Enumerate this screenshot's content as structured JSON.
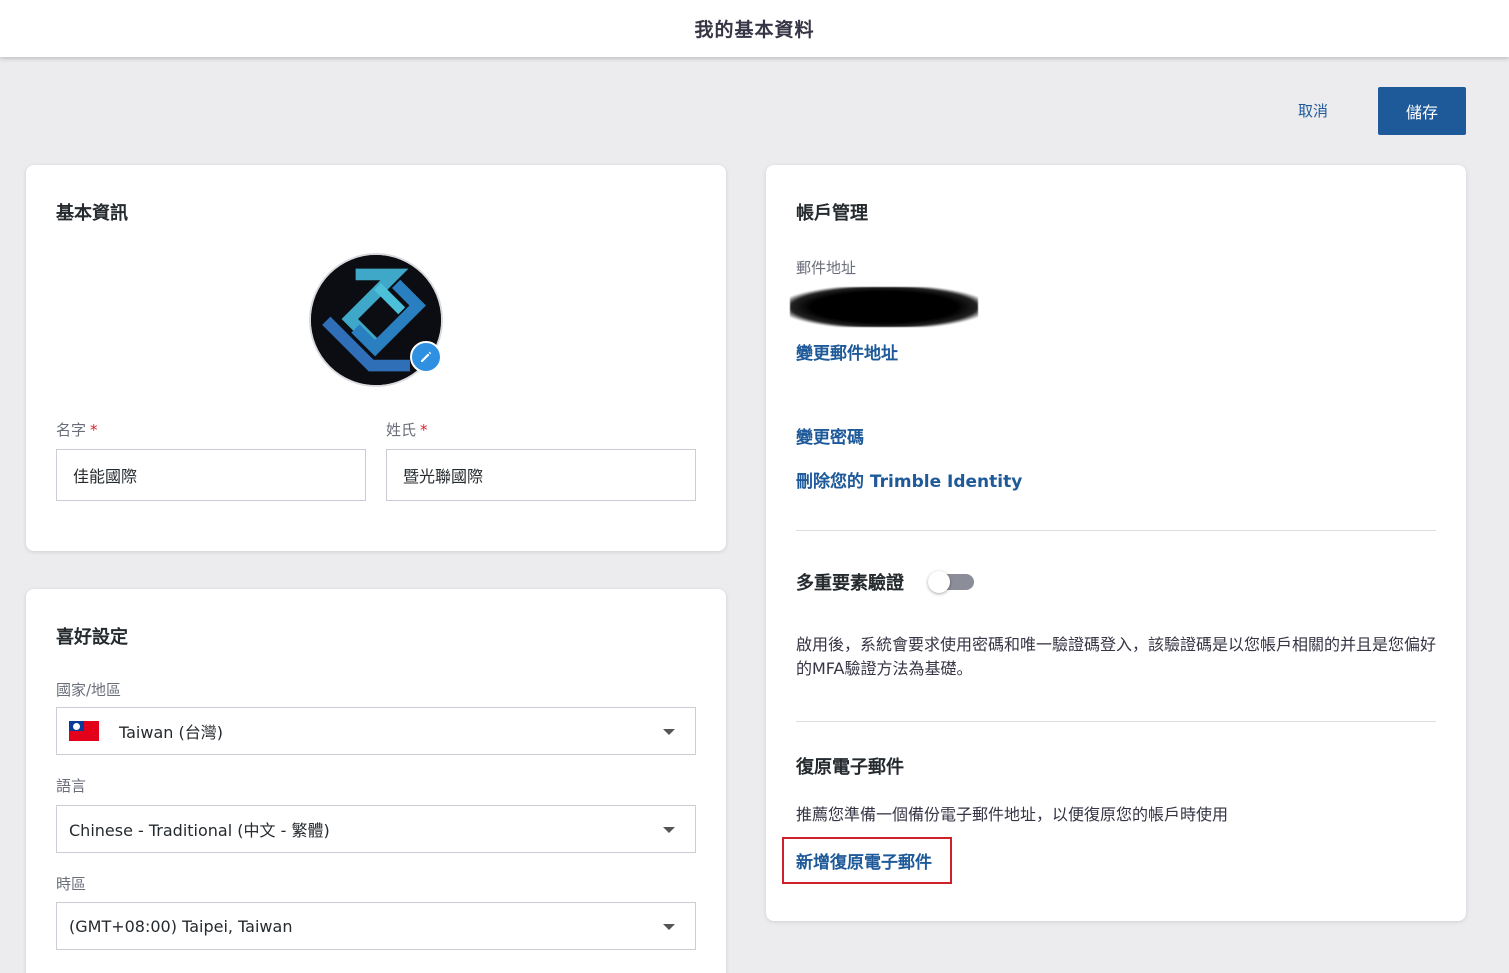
{
  "header": {
    "title": "我的基本資料"
  },
  "actions": {
    "cancel_label": "取消",
    "save_label": "儲存"
  },
  "basic_info": {
    "title": "基本資訊",
    "first_name": {
      "label": "名字",
      "required_mark": "*",
      "value": "佳能國際"
    },
    "last_name": {
      "label": "姓氏",
      "required_mark": "*",
      "value": "暨光聯國際"
    }
  },
  "preferences": {
    "title": "喜好設定",
    "country": {
      "label": "國家/地區",
      "value": "Taiwan (台灣)"
    },
    "language": {
      "label": "語言",
      "value": "Chinese - Traditional (中文 - 繁體)"
    },
    "timezone": {
      "label": "時區",
      "value": "(GMT+08:00) Taipei, Taiwan"
    }
  },
  "account": {
    "title": "帳戶管理",
    "email_label": "郵件地址",
    "change_email": "變更郵件地址",
    "change_password": "變更密碼",
    "delete_identity": "刪除您的 Trimble Identity",
    "mfa": {
      "title": "多重要素驗證",
      "enabled": false,
      "description": "啟用後，系統會要求使用密碼和唯一驗證碼登入，該驗證碼是以您帳戶相關的并且是您偏好的MFA驗證方法為基礎。"
    },
    "recovery": {
      "title": "復原電子郵件",
      "description": "推薦您準備一個備份電子郵件地址，以便復原您的帳戶時使用",
      "add_link": "新增復原電子郵件"
    }
  },
  "colors": {
    "primary": "#1e5a99",
    "required": "#da212c",
    "highlight": "#d0202a",
    "edit_badge": "#2f8fe0"
  }
}
